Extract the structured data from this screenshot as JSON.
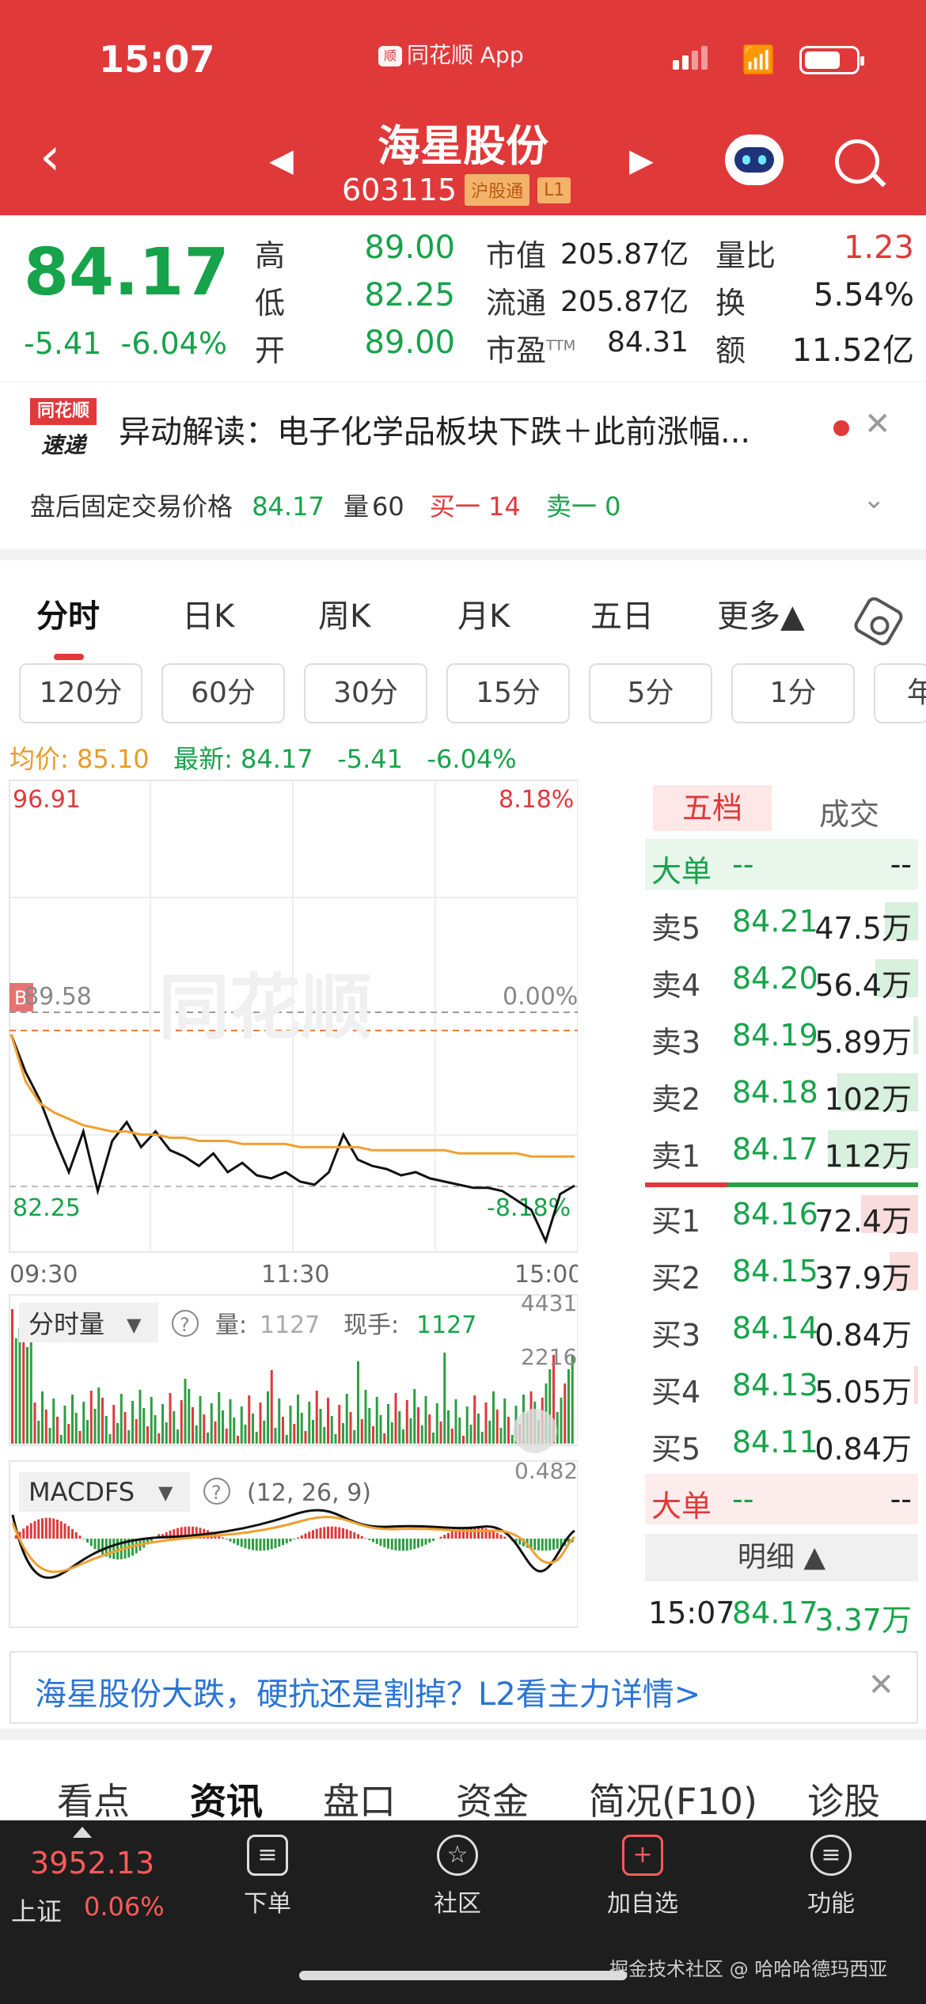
{
  "status": {
    "time": "15:07",
    "source_app": "同花顺 App"
  },
  "header": {
    "name": "海星股份",
    "code": "603115",
    "tags": [
      "沪股通",
      "L1"
    ]
  },
  "quote": {
    "last": "84.17",
    "change": "-5.41",
    "change_pct": "-6.04%",
    "high_label": "高",
    "high": "89.00",
    "low_label": "低",
    "low": "82.25",
    "open_label": "开",
    "open": "89.00",
    "mcap_label": "市值",
    "mcap": "205.87亿",
    "float_label": "流通",
    "float": "205.87亿",
    "pe_label": "市盈",
    "pe_sup": "TTM",
    "pe": "84.31",
    "vr_label": "量比",
    "vr": "1.23",
    "turn_label": "换",
    "turn": "5.54%",
    "amt_label": "额",
    "amt": "11.52亿"
  },
  "news": {
    "badge_top": "同花顺",
    "badge_bottom": "速递",
    "text": "异动解读：电子化学品板块下跌＋此前涨幅...",
    "after_label": "盘后固定交易价格",
    "after_price": "84.17",
    "after_vol_label": "量",
    "after_vol": "60",
    "buy1": "买一 14",
    "sell1": "卖一 0"
  },
  "tabs": [
    "分时",
    "日K",
    "周K",
    "月K",
    "五日",
    "更多▲"
  ],
  "periods": [
    "120分",
    "60分",
    "30分",
    "15分",
    "5分",
    "1分",
    "年"
  ],
  "stats": {
    "avg": "均价: 85.10",
    "latest": "最新: 84.17",
    "chg": "-5.41",
    "pct": "-6.04%"
  },
  "chart_data": {
    "type": "line",
    "price_high": "96.91",
    "price_mid": "89.58",
    "price_low": "82.25",
    "pct_high": "8.18%",
    "pct_mid": "0.00%",
    "pct_low": "-8.18%",
    "x_labels": [
      "09:30",
      "11:30",
      "15:00"
    ],
    "watermark": "同花顺",
    "ylim": [
      82.25,
      96.91
    ],
    "series": [
      {
        "color": "#111111",
        "values": [
          89.0,
          87.8,
          86.9,
          85.7,
          84.6,
          85.9,
          84.0,
          85.6,
          86.2,
          85.4,
          85.9,
          85.3,
          85.1,
          84.8,
          85.2,
          84.6,
          84.9,
          84.5,
          84.4,
          84.6,
          84.3,
          84.2,
          84.6,
          85.8,
          85.0,
          84.8,
          84.7,
          84.5,
          84.6,
          84.4,
          84.3,
          84.2,
          84.1,
          84.1,
          84.0,
          83.7,
          83.4,
          82.4,
          83.9,
          84.17
        ]
      },
      {
        "color": "#f0a030",
        "values": [
          89.0,
          87.5,
          86.8,
          86.5,
          86.3,
          86.1,
          86.0,
          85.9,
          85.9,
          85.8,
          85.8,
          85.7,
          85.7,
          85.6,
          85.6,
          85.6,
          85.5,
          85.5,
          85.5,
          85.5,
          85.4,
          85.4,
          85.4,
          85.4,
          85.4,
          85.3,
          85.3,
          85.3,
          85.3,
          85.3,
          85.3,
          85.2,
          85.2,
          85.2,
          85.2,
          85.2,
          85.1,
          85.1,
          85.1,
          85.1
        ]
      }
    ],
    "volume_label": "分时量",
    "volume_now": "量:",
    "volume_now_val": "1127",
    "volume_hand": "现手:",
    "volume_hand_val": "1127",
    "vol_max": "4431",
    "vol_mid": "2216",
    "macd_label": "MACDFS",
    "macd_params": "(12, 26, 9)",
    "macd_max": "0.482"
  },
  "orderbook": {
    "title": "五档",
    "title2": "成交",
    "big_label": "大单",
    "dash": "--",
    "asks": [
      {
        "label": "卖5",
        "price": "84.21",
        "vol": "47.5万",
        "fill": 0.35
      },
      {
        "label": "卖4",
        "price": "84.20",
        "vol": "56.4万",
        "fill": 0.45
      },
      {
        "label": "卖3",
        "price": "84.19",
        "vol": "5.89万",
        "fill": 0.05
      },
      {
        "label": "卖2",
        "price": "84.18",
        "vol": "102万",
        "fill": 0.85
      },
      {
        "label": "卖1",
        "price": "84.17",
        "vol": "112万",
        "fill": 0.95
      }
    ],
    "bids": [
      {
        "label": "买1",
        "price": "84.16",
        "vol": "72.4万",
        "fill": 0.6
      },
      {
        "label": "买2",
        "price": "84.15",
        "vol": "37.9万",
        "fill": 0.3
      },
      {
        "label": "买3",
        "price": "84.14",
        "vol": "0.84万",
        "fill": 0.0
      },
      {
        "label": "买4",
        "price": "84.13",
        "vol": "5.05万",
        "fill": 0.04
      },
      {
        "label": "买5",
        "price": "84.11",
        "vol": "0.84万",
        "fill": 0.0
      }
    ],
    "detail": "明细 ▲",
    "trade": {
      "time": "15:07",
      "price": "84.17",
      "vol": "3.37万"
    }
  },
  "promo": "海星股份大跌，硬抗还是割掉？L2看主力详情>",
  "bottom_tabs": [
    "看点",
    "资讯",
    "盘口",
    "资金",
    "简况(F10)",
    "诊股"
  ],
  "dock": {
    "index_value": "3952.13",
    "index_name": "上证",
    "index_chg": "0.06%",
    "items": [
      "下单",
      "社区",
      "加自选",
      "功能"
    ],
    "credit": "掘金技术社区 @ 哈哈哈德玛西亚"
  }
}
